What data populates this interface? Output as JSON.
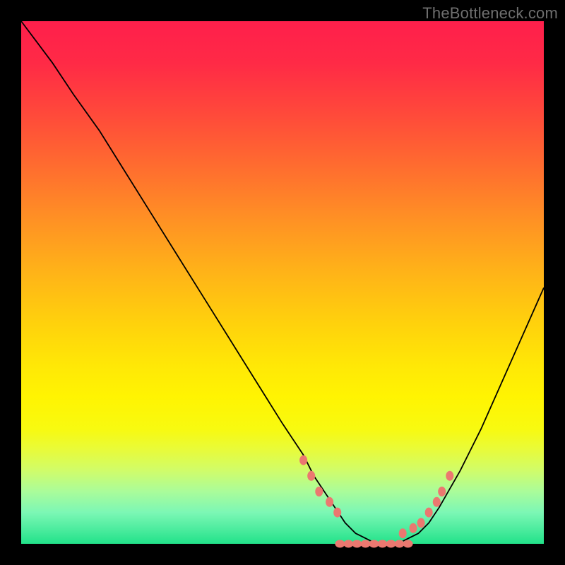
{
  "watermark": "TheBottleneck.com",
  "chart_data": {
    "type": "line",
    "title": "",
    "xlabel": "",
    "ylabel": "",
    "xlim": [
      0,
      100
    ],
    "ylim": [
      0,
      100
    ],
    "grid": false,
    "legend": false,
    "series": [
      {
        "name": "bottleneck-curve",
        "x": [
          0,
          3,
          6,
          10,
          15,
          20,
          25,
          30,
          35,
          40,
          45,
          50,
          52,
          54,
          56,
          58,
          60,
          62,
          64,
          66,
          68,
          70,
          72,
          74,
          76,
          78,
          80,
          84,
          88,
          92,
          96,
          100
        ],
        "y": [
          100,
          96,
          92,
          86,
          79,
          71,
          63,
          55,
          47,
          39,
          31,
          23,
          20,
          17,
          13,
          10,
          7,
          4,
          2,
          1,
          0,
          0,
          0,
          1,
          2,
          4,
          7,
          14,
          22,
          31,
          40,
          49
        ]
      }
    ],
    "markers": {
      "name": "optimal-range-dots",
      "x": [
        54,
        55.5,
        57,
        59,
        60.5,
        73,
        75,
        76.5,
        78,
        79.5,
        80.5,
        82
      ],
      "y": [
        16,
        13,
        10,
        8,
        6,
        2,
        3,
        4,
        6,
        8,
        10,
        13
      ]
    },
    "flat_segment": {
      "name": "zero-bottleneck-band",
      "x": [
        61,
        74
      ],
      "y": [
        0,
        0
      ]
    }
  },
  "colors": {
    "background": "#000000",
    "curve": "#000000",
    "marker": "#eb7870",
    "gradient_top": "#ff1f4b",
    "gradient_bottom": "#22e28a"
  }
}
